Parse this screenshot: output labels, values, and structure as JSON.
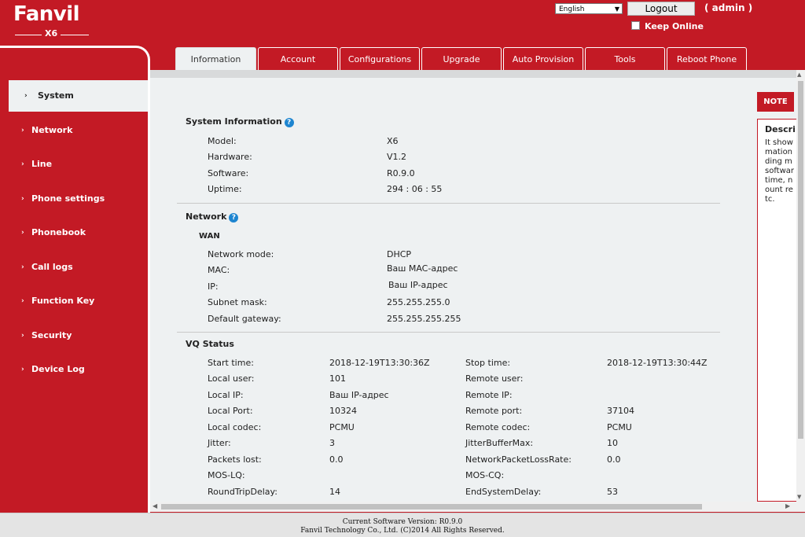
{
  "header": {
    "brand": "Fanvil",
    "model": "X6",
    "language": "English",
    "logout_label": "Logout",
    "user": "( admin )",
    "keep_online": "Keep Online"
  },
  "tabs": [
    "Information",
    "Account",
    "Configurations",
    "Upgrade",
    "Auto Provision",
    "Tools",
    "Reboot Phone"
  ],
  "sidebar": [
    "System",
    "Network",
    "Line",
    "Phone settings",
    "Phonebook",
    "Call logs",
    "Function Key",
    "Security",
    "Device Log"
  ],
  "system_info": {
    "title": "System Information",
    "rows": [
      {
        "label": "Model:",
        "value": "X6"
      },
      {
        "label": "Hardware:",
        "value": "V1.2"
      },
      {
        "label": "Software:",
        "value": "R0.9.0"
      },
      {
        "label": "Uptime:",
        "value": "294 : 06 : 55"
      }
    ]
  },
  "network": {
    "title": "Network",
    "wan_title": "WAN",
    "rows": [
      {
        "label": "Network mode:",
        "value": "DHCP"
      },
      {
        "label": "MAC:",
        "value": "Ваш MAC-адрес"
      },
      {
        "label": "IP:",
        "value": "Ваш IP-адрес"
      },
      {
        "label": "Subnet mask:",
        "value": "255.255.255.0"
      },
      {
        "label": "Default gateway:",
        "value": "255.255.255.255"
      }
    ]
  },
  "vq_status": {
    "title": "VQ Status",
    "rows": [
      {
        "l1": "Start time:",
        "v1": "2018-12-19T13:30:36Z",
        "l2": "Stop time:",
        "v2": "2018-12-19T13:30:44Z"
      },
      {
        "l1": "Local user:",
        "v1": "101",
        "l2": "Remote user:",
        "v2": ""
      },
      {
        "l1": "Local IP:",
        "v1": "Ваш IP-адрес",
        "l2": "Remote IP:",
        "v2": ""
      },
      {
        "l1": "Local Port:",
        "v1": "10324",
        "l2": "Remote port:",
        "v2": "37104"
      },
      {
        "l1": "Local codec:",
        "v1": "PCMU",
        "l2": "Remote codec:",
        "v2": "PCMU"
      },
      {
        "l1": "Jitter:",
        "v1": "3",
        "l2": "JitterBufferMax:",
        "v2": "10"
      },
      {
        "l1": "Packets lost:",
        "v1": "0.0",
        "l2": "NetworkPacketLossRate:",
        "v2": "0.0"
      },
      {
        "l1": "MOS-LQ:",
        "v1": "",
        "l2": "MOS-CQ:",
        "v2": ""
      },
      {
        "l1": "RoundTripDelay:",
        "v1": "14",
        "l2": "EndSystemDelay:",
        "v2": "53"
      }
    ]
  },
  "note": {
    "tab_label": "NOTE",
    "title": "Descri",
    "body": [
      "It show",
      "mation",
      "ding m",
      "softwar",
      "time, n",
      "ount re",
      "tc."
    ]
  },
  "footer": {
    "version": "Current Software Version: R0.9.0",
    "copyright": "Fanvil Technology Co., Ltd. (C)2014 All Rights Reserved."
  },
  "colors": {
    "brand_red": "#c31a25",
    "content_bg": "#eef1f2",
    "help_blue": "#1d85d0"
  }
}
